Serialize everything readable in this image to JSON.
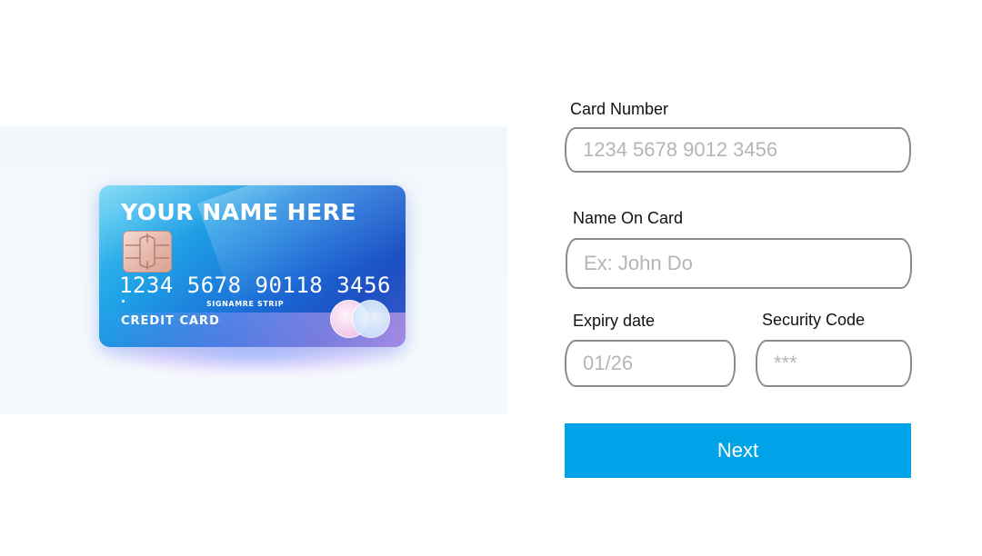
{
  "card_preview": {
    "name": "YOUR NAME HERE",
    "number": "1234 5678 90118 3456",
    "strip_text": "SIGNAMRE STRIP",
    "type_label": "CREDIT  CARD"
  },
  "form": {
    "card_number": {
      "label": "Card Number",
      "placeholder": "1234 5678 9012 3456"
    },
    "name_on_card": {
      "label": "Name On Card",
      "placeholder": "Ex: John Do"
    },
    "expiry_date": {
      "label": "Expiry date",
      "placeholder": "01/26"
    },
    "security_code": {
      "label": "Security Code",
      "placeholder": "***"
    },
    "next_label": "Next"
  },
  "colors": {
    "primary_button": "#00a2e8",
    "field_border": "#8a8a8a",
    "placeholder_text": "#b5b5b5"
  }
}
